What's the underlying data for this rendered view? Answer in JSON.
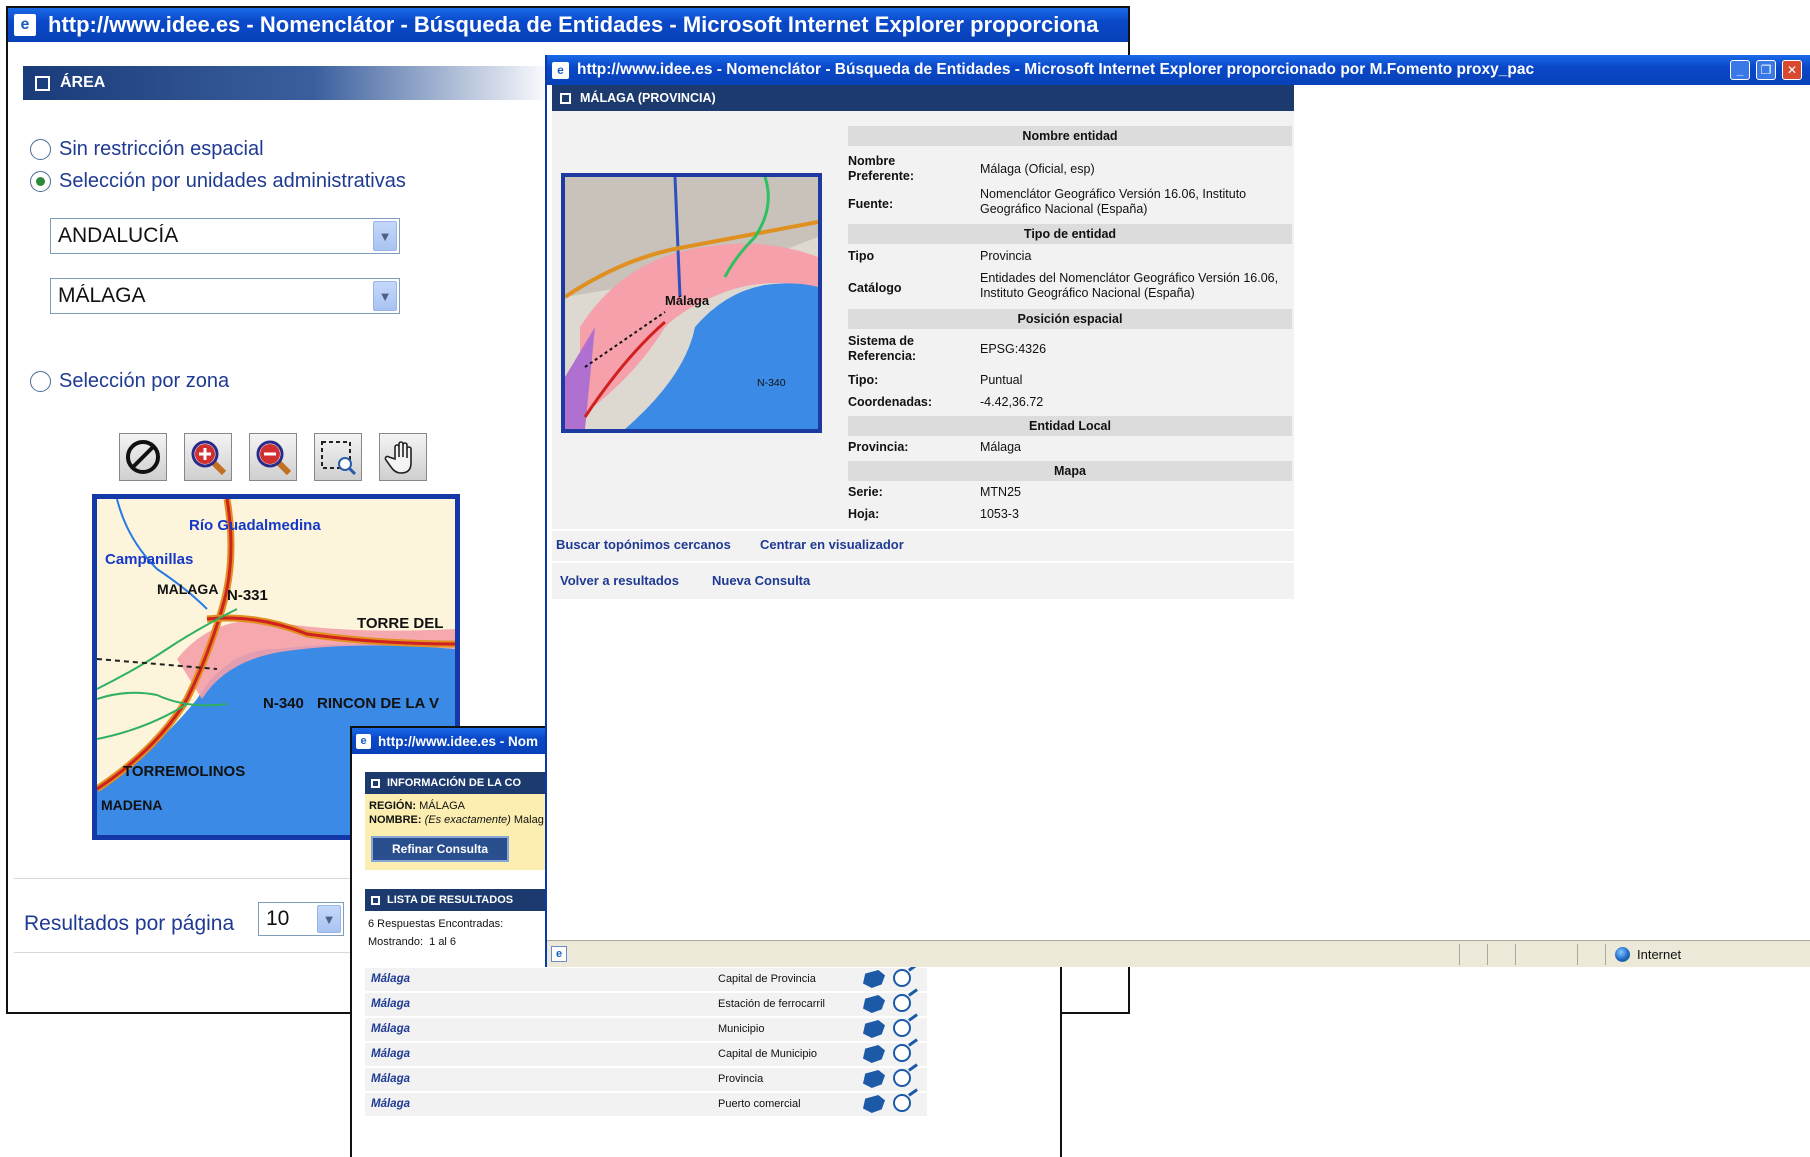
{
  "win1": {
    "title": "http://www.idee.es - Nomenclátor - Búsqueda de Entidades - Microsoft Internet Explorer proporciona",
    "area_header": "ÁREA",
    "radio_no_restriction": "Sin restricción espacial",
    "radio_admin_units": "Selección por unidades administrativas",
    "select_region": "ANDALUCÍA",
    "select_province": "MÁLAGA",
    "radio_zone": "Selección por zona",
    "map_labels": {
      "rio": "Río Guadalmedina",
      "campanillas": "Campanillas",
      "malaga": "MALAGA",
      "n331": "N-331",
      "torre": "TORRE DEL",
      "n340": "N-340",
      "rincon": "RINCON DE LA V",
      "torremolinos": "TORREMOLINOS",
      "madena": "MADENA"
    },
    "results_per_page_label": "Resultados por página",
    "results_per_page_value": "10"
  },
  "win2": {
    "title": "http://www.idee.es - Nomenclátor - Búsqueda de Entidades - Microsoft Internet Explorer proporcionado por M.Fomento proxy_pac",
    "section_header": "MÁLAGA (PROVINCIA)",
    "map_labels": {
      "malaga": "Málaga",
      "n340": "N-340"
    },
    "headers": {
      "nombre": "Nombre entidad",
      "tipo": "Tipo de entidad",
      "posicion": "Posición espacial",
      "entidad_local": "Entidad Local",
      "mapa": "Mapa"
    },
    "rows": {
      "nombre_pref_label": "Nombre Preferente:",
      "nombre_pref_value": "Málaga (Oficial, esp)",
      "fuente_label": "Fuente:",
      "fuente_value": "Nomenclátor Geográfico Versión 16.06, Instituto Geográfico Nacional (España)",
      "tipo_label": "Tipo",
      "tipo_value": "Provincia",
      "catalogo_label": "Catálogo",
      "catalogo_value": "Entidades del Nomenclátor Geográfico Versión 16.06, Instituto Geográfico Nacional (España)",
      "sistema_label": "Sistema de Referencia:",
      "sistema_value": "EPSG:4326",
      "tipo2_label": "Tipo:",
      "tipo2_value": "Puntual",
      "coord_label": "Coordenadas:",
      "coord_value": "-4.42,36.72",
      "provincia_label": "Provincia:",
      "provincia_value": "Málaga",
      "serie_label": "Serie:",
      "serie_value": "MTN25",
      "hoja_label": "Hoja:",
      "hoja_value": "1053-3"
    },
    "links": {
      "buscar": "Buscar topónimos cercanos",
      "centrar": "Centrar en visualizador",
      "volver": "Volver a resultados",
      "nueva": "Nueva Consulta"
    },
    "status_zone": "Internet"
  },
  "win3": {
    "title": "http://www.idee.es - Nom",
    "info_header": "INFORMACIÓN DE LA CO",
    "region_label": "REGIÓN:",
    "region_value": "MÁLAGA",
    "nombre_label": "NOMBRE:",
    "nombre_value_italic": "(Es exactamente)",
    "nombre_value": "Malag",
    "refine_button": "Refinar Consulta",
    "list_header": "LISTA DE RESULTADOS",
    "found_text": "6 Respuestas Encontradas:",
    "showing_text": "Mostrando:  1 al 6",
    "results": [
      {
        "name": "Málaga",
        "type": "Capital de Provincia"
      },
      {
        "name": "Málaga",
        "type": "Estación de ferrocarril"
      },
      {
        "name": "Málaga",
        "type": "Municipio"
      },
      {
        "name": "Málaga",
        "type": "Capital de Municipio"
      },
      {
        "name": "Málaga",
        "type": "Provincia"
      },
      {
        "name": "Málaga",
        "type": "Puerto comercial"
      }
    ]
  },
  "colors": {
    "title_blue": "#0a48c8",
    "header_navy": "#1c3a6e",
    "link_blue": "#1f3a93",
    "sea_blue": "#3a8ae6",
    "urban_pink": "#f5a0aa"
  }
}
